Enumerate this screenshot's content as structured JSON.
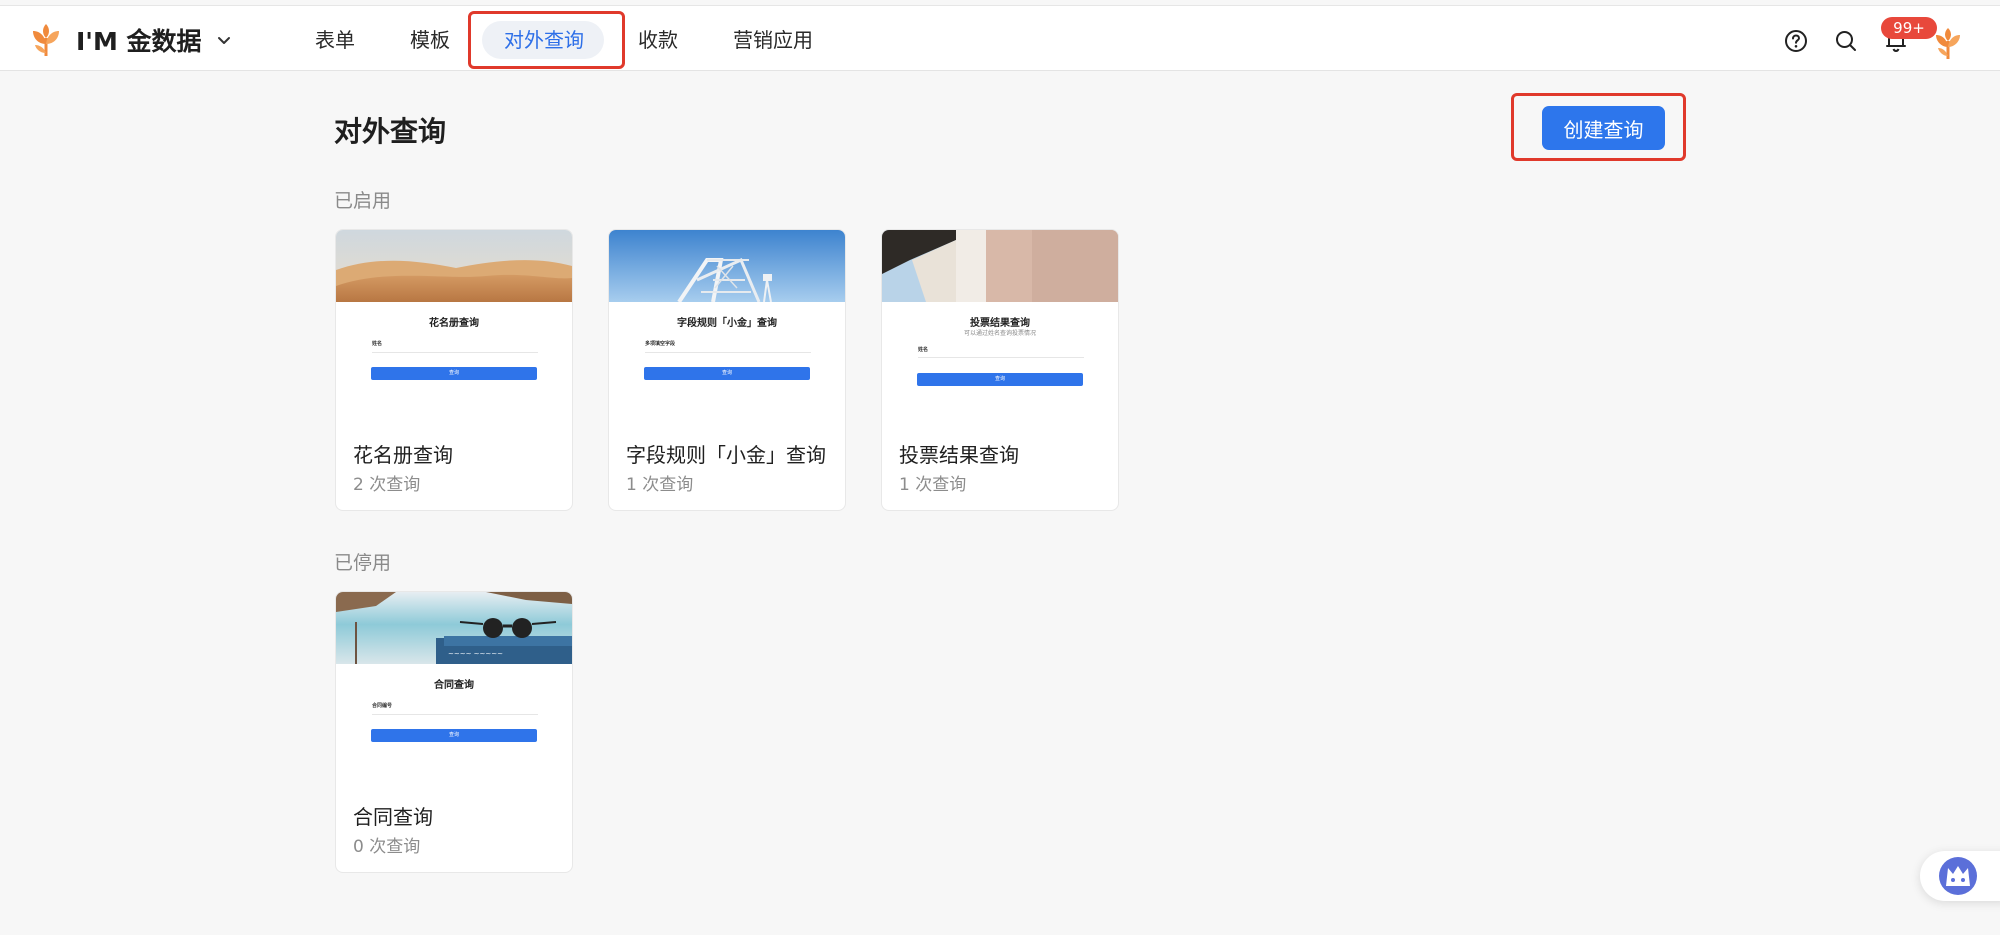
{
  "app": {
    "name": "I'M 金数据"
  },
  "nav": {
    "items": [
      {
        "label": "表单"
      },
      {
        "label": "模板"
      },
      {
        "label": "对外查询"
      },
      {
        "label": "收款"
      },
      {
        "label": "营销应用"
      }
    ],
    "active_index": 2
  },
  "toolbar": {
    "notification_count": "99+"
  },
  "page": {
    "title": "对外查询",
    "create_button": "创建查询"
  },
  "sections": {
    "enabled": {
      "label": "已启用",
      "cards": [
        {
          "name": "花名册查询",
          "count": "2 次查询",
          "preview": {
            "title": "花名册查询",
            "field": "姓名",
            "button": "查询"
          }
        },
        {
          "name": "字段规则「小金」查询",
          "count": "1 次查询",
          "preview": {
            "title": "字段规则「小金」查询",
            "field": "多项填空字段",
            "button": "查询"
          }
        },
        {
          "name": "投票结果查询",
          "count": "1 次查询",
          "preview": {
            "title": "投票结果查询",
            "subtitle": "可以通过姓名查询投票情况",
            "field": "姓名",
            "button": "查询"
          }
        }
      ]
    },
    "disabled": {
      "label": "已停用",
      "cards": [
        {
          "name": "合同查询",
          "count": "0 次查询",
          "preview": {
            "title": "合同查询",
            "field": "合同编号",
            "button": "查询"
          }
        }
      ]
    }
  },
  "colors": {
    "accent": "#2d76ec",
    "highlight": "#e0392b",
    "badge": "#e8483b",
    "brand_orange": "#f08a3c"
  }
}
